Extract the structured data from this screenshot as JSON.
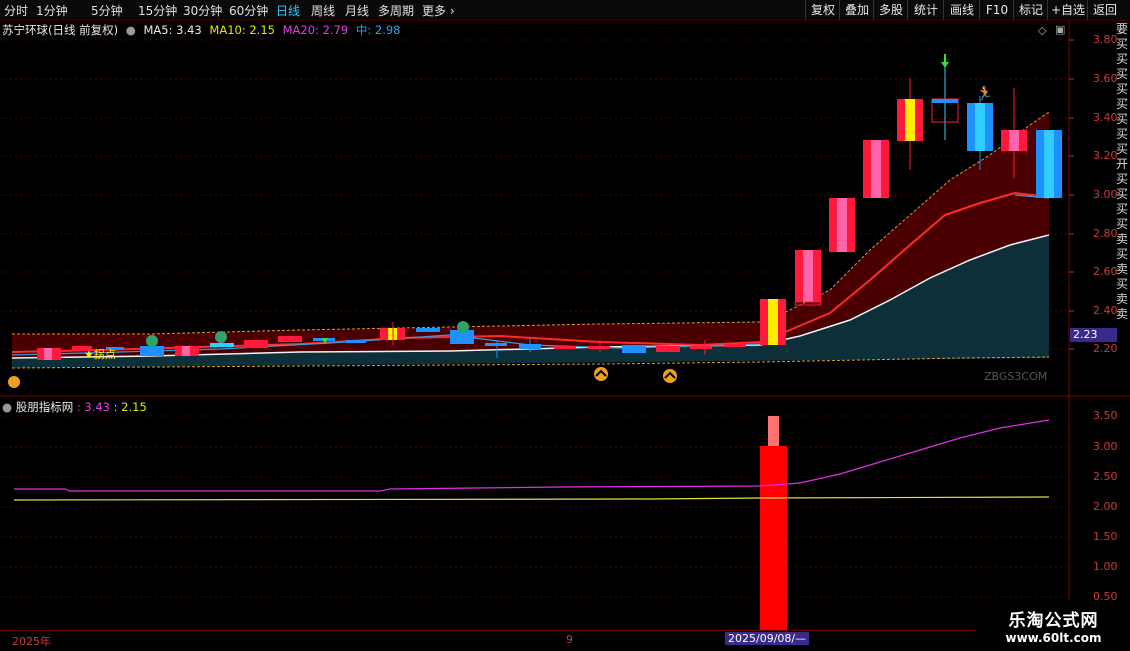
{
  "toolbar": {
    "tabs": [
      "分时",
      "1分钟",
      "5分钟",
      "15分钟",
      "30分钟",
      "60分钟",
      "日线",
      "周线",
      "月线",
      "多周期",
      "更多"
    ],
    "active_tab": "日线",
    "right_buttons": [
      "复权",
      "叠加",
      "多股",
      "统计",
      "画线",
      "F10",
      "标记",
      "+自选",
      "返回"
    ]
  },
  "header": {
    "stock": "苏宁环球(日线 前复权)",
    "ma5": "MA5: 3.43",
    "ma10": "MA10: 2.15",
    "ma20": "MA20: 2.79",
    "mid": "中: 2.98"
  },
  "indicator": {
    "name": "股朋指标网",
    "v1": ": 3.43",
    "v2": ": 2.15"
  },
  "price_axis": [
    "3.80",
    "3.60",
    "3.40",
    "3.20",
    "3.00",
    "2.80",
    "2.60",
    "2.40",
    "2.20"
  ],
  "indicator_axis": [
    "3.50",
    "3.00",
    "2.50",
    "2.00",
    "1.50",
    "1.00",
    "0.50"
  ],
  "current_price": "2.23",
  "annotation": "★拐点",
  "chart_watermark": "ZBGS3COM",
  "dates": {
    "year": "2025年",
    "mid": "9",
    "cursor": "2025/09/08/—"
  },
  "right_strip": "要买买买买买买买买开买买买买卖买卖买卖卖",
  "site": {
    "name": "乐淘公式网",
    "url": "www.60lt.com"
  },
  "colors": {
    "up": "#ff1a3c",
    "down": "#1e90ff",
    "ma_red": "#ff2a2a",
    "band": "#4a0000",
    "teal": "#0d2f3a"
  }
}
